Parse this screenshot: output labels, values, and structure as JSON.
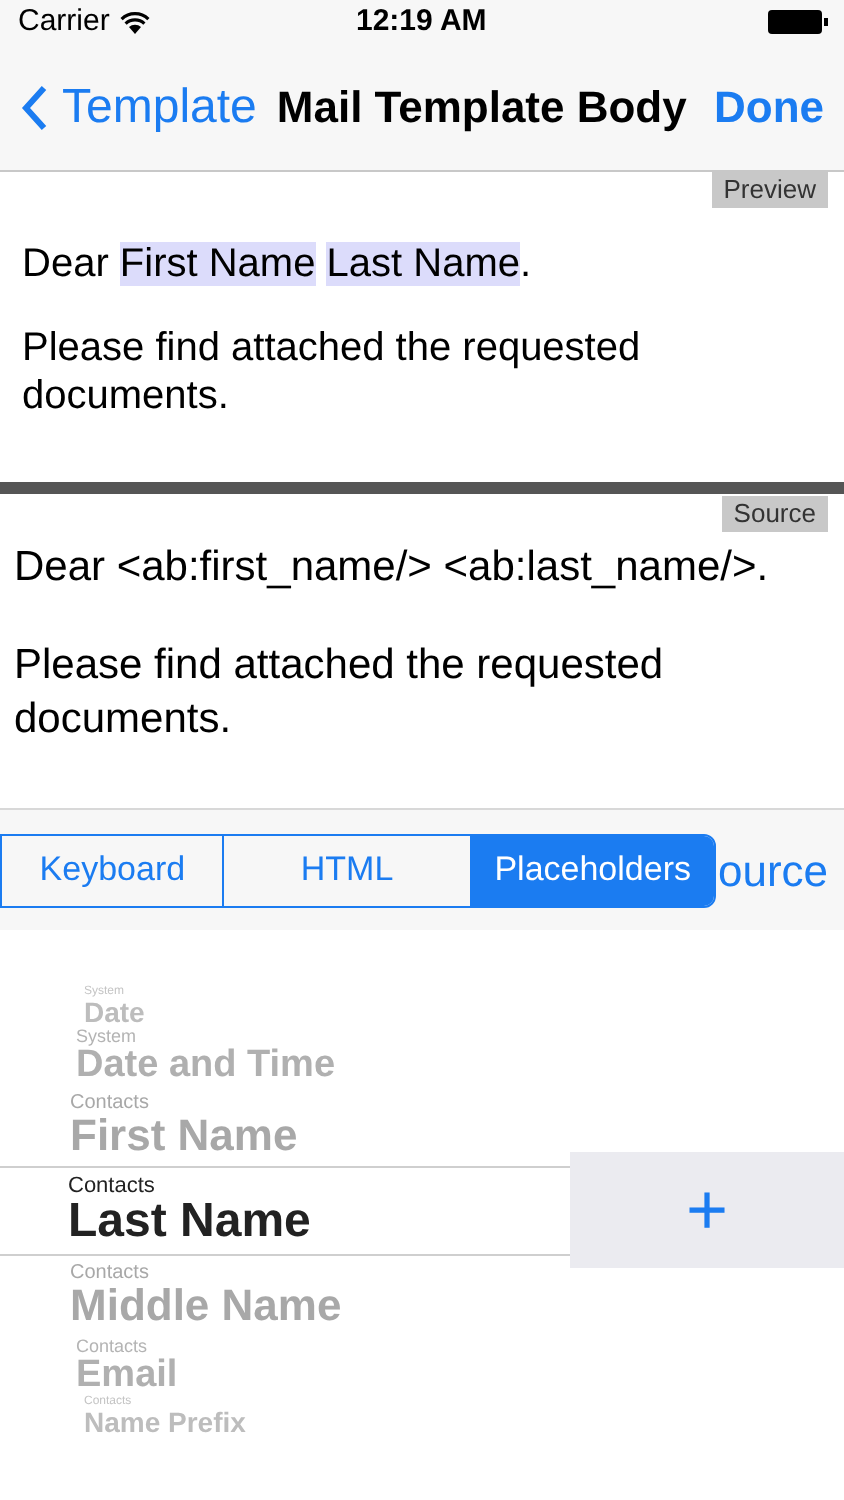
{
  "status_bar": {
    "carrier": "Carrier",
    "time": "12:19 AM"
  },
  "nav": {
    "back": "Template",
    "title": "Mail Template Body",
    "done": "Done"
  },
  "preview": {
    "tag": "Preview",
    "greeting": {
      "word": "Dear",
      "placeholders": [
        "First Name",
        "Last Name"
      ],
      "end": "."
    },
    "body": "Please find attached the requested documents."
  },
  "source": {
    "tag": "Source",
    "paragraphs": [
      "Dear <ab:first_name/> <ab:last_name/>.",
      "Please find attached the requested documents."
    ]
  },
  "segments": [
    {
      "label": "Keyboard",
      "selected": false
    },
    {
      "label": "HTML",
      "selected": false
    },
    {
      "label": "Placeholders",
      "selected": true
    }
  ],
  "hidden_button": "ource",
  "picker": [
    {
      "group": "System",
      "name": "Date",
      "selected": false
    },
    {
      "group": "System",
      "name": "Date and Time",
      "selected": false
    },
    {
      "group": "Contacts",
      "name": "First Name",
      "selected": false
    },
    {
      "group": "Contacts",
      "name": "Last Name",
      "selected": true
    },
    {
      "group": "Contacts",
      "name": "Middle Name",
      "selected": false
    },
    {
      "group": "Contacts",
      "name": "Email",
      "selected": false
    },
    {
      "group": "Contacts",
      "name": "Name Prefix",
      "selected": false
    }
  ],
  "add_button": "+"
}
